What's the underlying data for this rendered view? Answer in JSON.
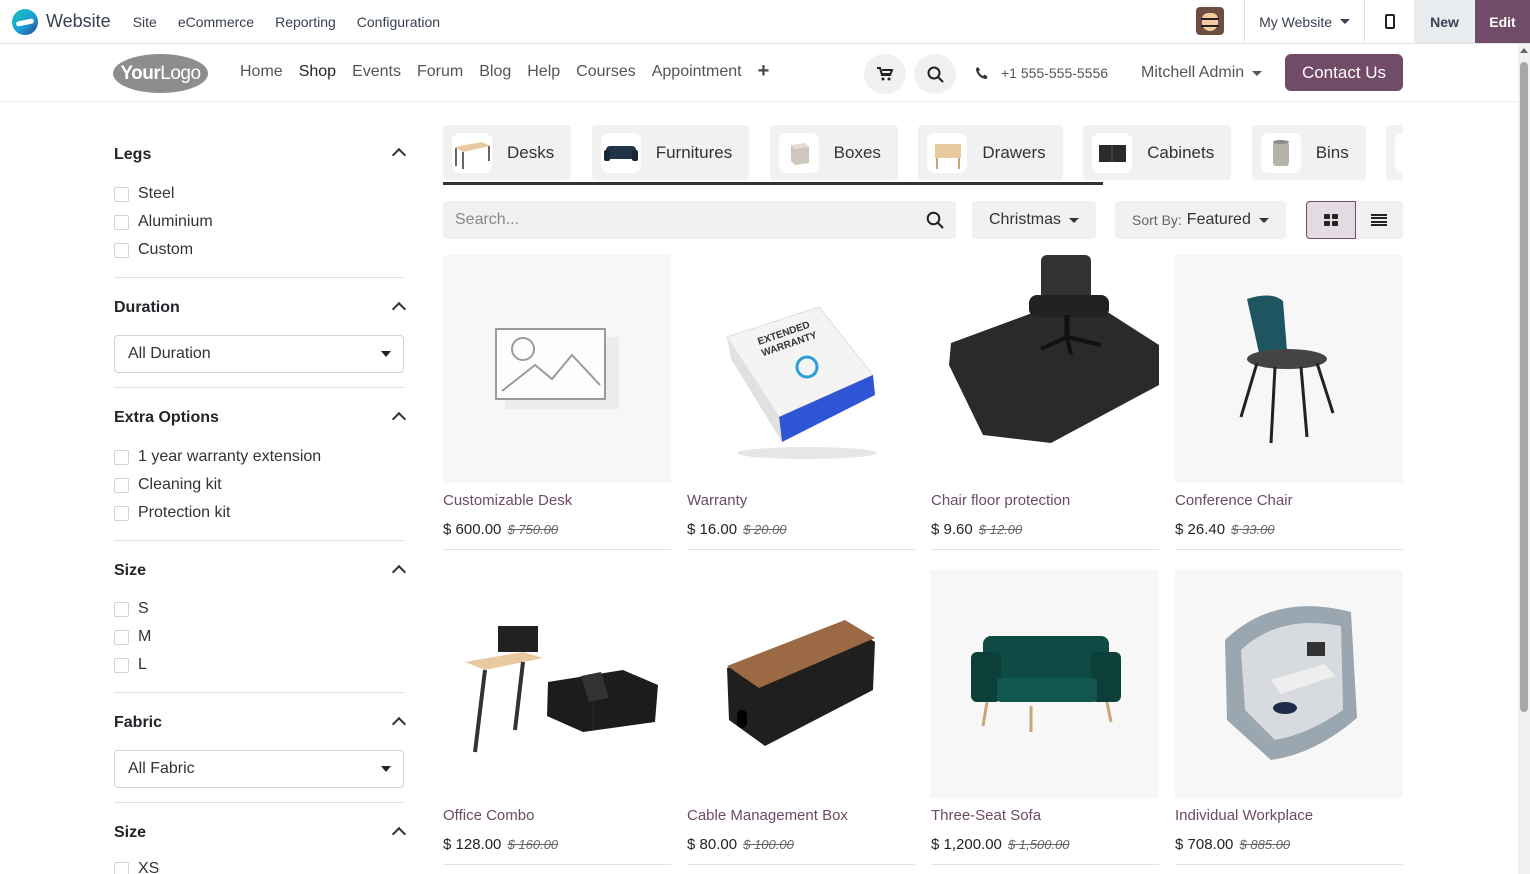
{
  "admin_bar": {
    "app_name": "Website",
    "menu": [
      "Site",
      "eCommerce",
      "Reporting",
      "Configuration"
    ],
    "website_switch": "My Website",
    "new_label": "New",
    "edit_label": "Edit"
  },
  "header": {
    "logo_text_1": "Your",
    "logo_text_2": "Logo",
    "nav": [
      "Home",
      "Shop",
      "Events",
      "Forum",
      "Blog",
      "Help",
      "Courses",
      "Appointment"
    ],
    "active_nav": "Shop",
    "phone": "+1 555-555-5556",
    "user": "Mitchell Admin",
    "contact_label": "Contact Us"
  },
  "filters": {
    "legs": {
      "title": "Legs",
      "options": [
        "Steel",
        "Aluminium",
        "Custom"
      ]
    },
    "duration": {
      "title": "Duration",
      "selected": "All Duration"
    },
    "extra": {
      "title": "Extra Options",
      "options": [
        "1 year warranty extension",
        "Cleaning kit",
        "Protection kit"
      ]
    },
    "size": {
      "title": "Size",
      "options": [
        "S",
        "M",
        "L"
      ]
    },
    "fabric": {
      "title": "Fabric",
      "selected": "All Fabric"
    },
    "size2": {
      "title": "Size",
      "options": [
        "XS"
      ]
    }
  },
  "categories": [
    "Desks",
    "Furnitures",
    "Boxes",
    "Drawers",
    "Cabinets",
    "Bins"
  ],
  "toolbar": {
    "search_placeholder": "Search...",
    "pricelist": "Christmas",
    "sort_prefix": "Sort By:",
    "sort_value": "Featured"
  },
  "products": [
    {
      "name": "Customizable Desk",
      "price": "$ 600.00",
      "old_price": "$ 750.00"
    },
    {
      "name": "Warranty",
      "price": "$ 16.00",
      "old_price": "$ 20.00"
    },
    {
      "name": "Chair floor protection",
      "price": "$ 9.60",
      "old_price": "$ 12.00"
    },
    {
      "name": "Conference Chair",
      "price": "$ 26.40",
      "old_price": "$ 33.00"
    },
    {
      "name": "Office Combo",
      "price": "$ 128.00",
      "old_price": "$ 160.00"
    },
    {
      "name": "Cable Management Box",
      "price": "$ 80.00",
      "old_price": "$ 100.00"
    },
    {
      "name": "Three-Seat Sofa",
      "price": "$ 1,200.00",
      "old_price": "$ 1,500.00"
    },
    {
      "name": "Individual Workplace",
      "price": "$ 708.00",
      "old_price": "$ 885.00"
    }
  ],
  "product_image_texts": {
    "warranty_box": "EXTENDED WARRANTY"
  },
  "colors": {
    "brand": "#714b67",
    "product_link": "#6e4a64"
  }
}
